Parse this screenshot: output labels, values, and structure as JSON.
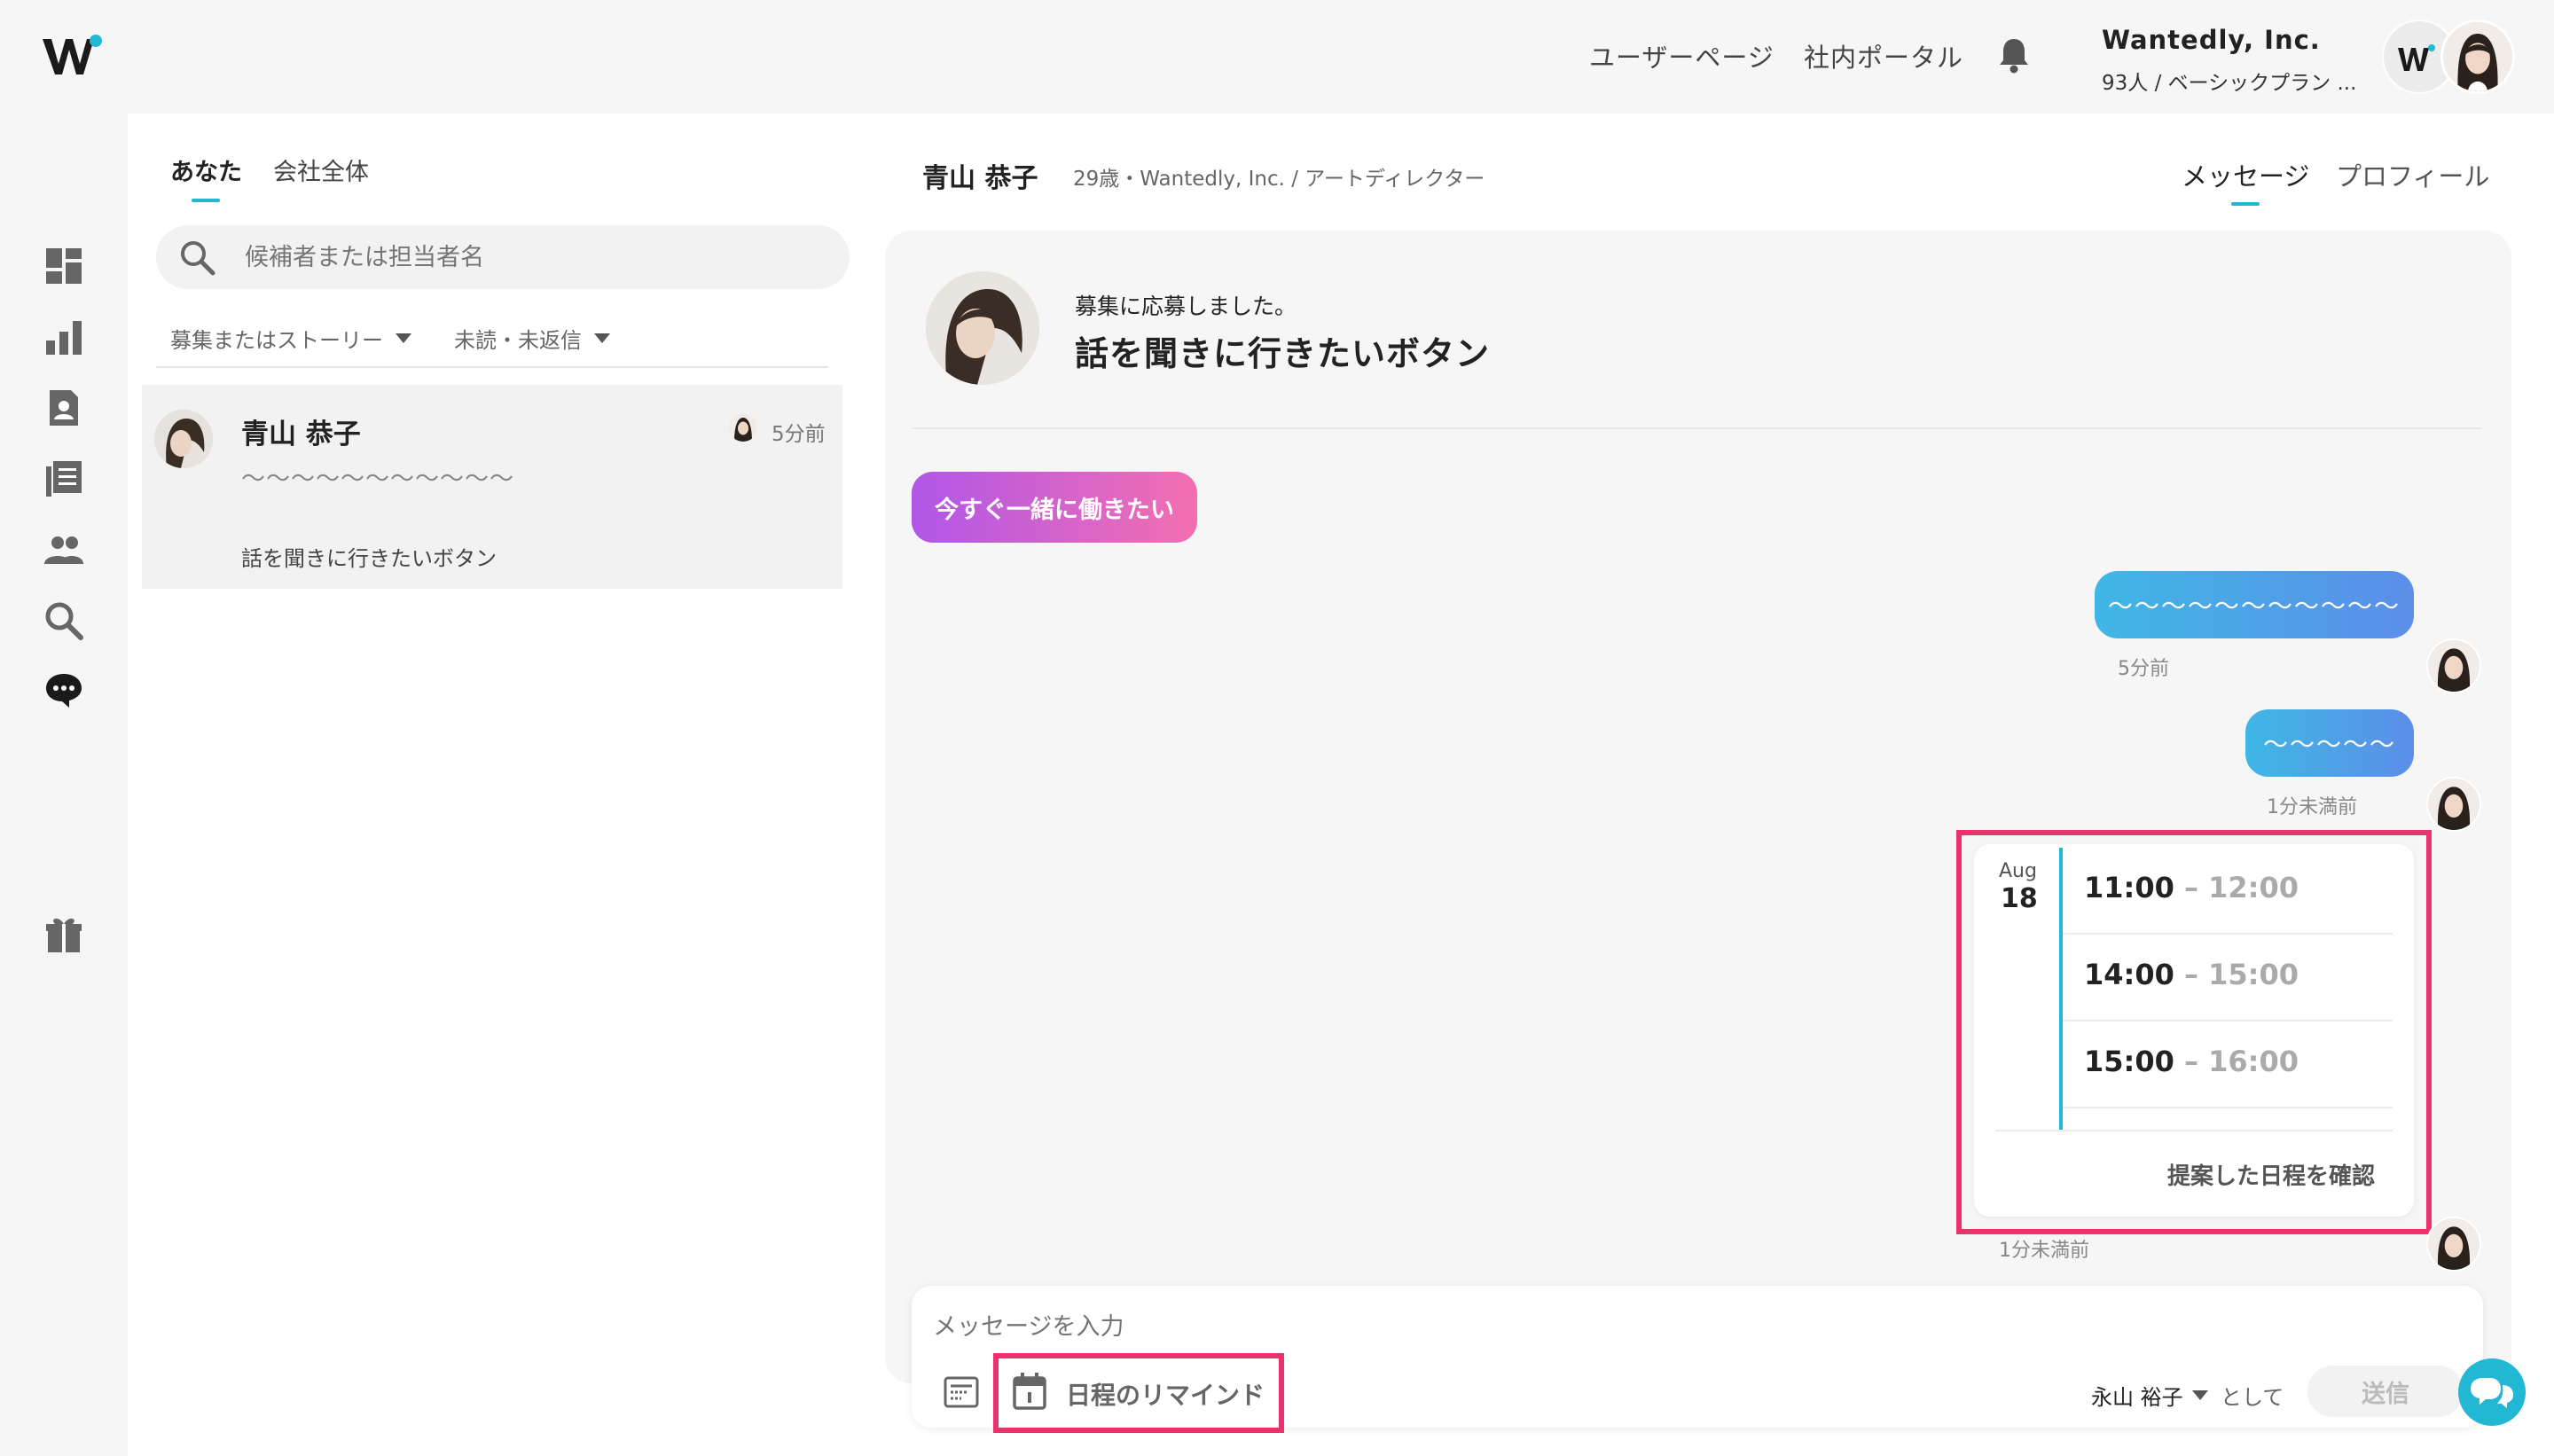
{
  "header": {
    "user_page": "ユーザーページ",
    "portal": "社内ポータル",
    "company_name": "Wantedly, Inc.",
    "company_plan": "93人 / ベーシックプラン ..."
  },
  "list": {
    "tabs": [
      "あなた",
      "会社全体"
    ],
    "search_placeholder": "候補者または担当者名",
    "filters": [
      "募集またはストーリー",
      "未読・未返信"
    ],
    "conversation": {
      "name": "青山 恭子",
      "time": "5分前",
      "preview": "〜〜〜〜〜〜〜〜〜〜〜",
      "application": "話を聞きに行きたいボタン"
    }
  },
  "chat": {
    "name": "青山 恭子",
    "subtitle": "29歳・Wantedly, Inc. / アートディレクター",
    "tabs": [
      "メッセージ",
      "プロフィール"
    ],
    "applied_label": "募集に応募しました。",
    "applied_title": "話を聞きに行きたいボタン",
    "interest_badge": "今すぐ一緒に働きたい",
    "messages": [
      {
        "text": "〜〜〜〜〜〜〜〜〜〜〜",
        "time": "5分前"
      },
      {
        "text": "〜〜〜〜〜",
        "time": "1分未満前"
      }
    ],
    "schedule": {
      "month": "Aug",
      "day": "18",
      "slots": [
        {
          "start": "11:00",
          "end": " – 12:00"
        },
        {
          "start": "14:00",
          "end": " – 15:00"
        },
        {
          "start": "15:00",
          "end": " – 16:00"
        }
      ],
      "confirm": "提案した日程を確認",
      "time": "1分未満前"
    },
    "composer": {
      "placeholder": "メッセージを入力",
      "remind": "日程のリマインド",
      "sender": "永山 裕子",
      "as": "として",
      "send": "送信"
    }
  },
  "colors": {
    "accent": "#22b8d4",
    "highlight": "#e8336d",
    "bubble_start": "#3fb7e6",
    "bubble_end": "#5c8ee8",
    "badge_start": "#b056e8",
    "badge_end": "#f46fb0"
  },
  "icons": [
    "wantedly-logo",
    "bell-icon",
    "dashboard-icon",
    "bar-chart-icon",
    "contact-card-icon",
    "list-icon",
    "people-icon",
    "search-icon",
    "chat-bubble-icon",
    "gift-icon",
    "template-icon",
    "calendar-icon",
    "help-chat-icon"
  ]
}
